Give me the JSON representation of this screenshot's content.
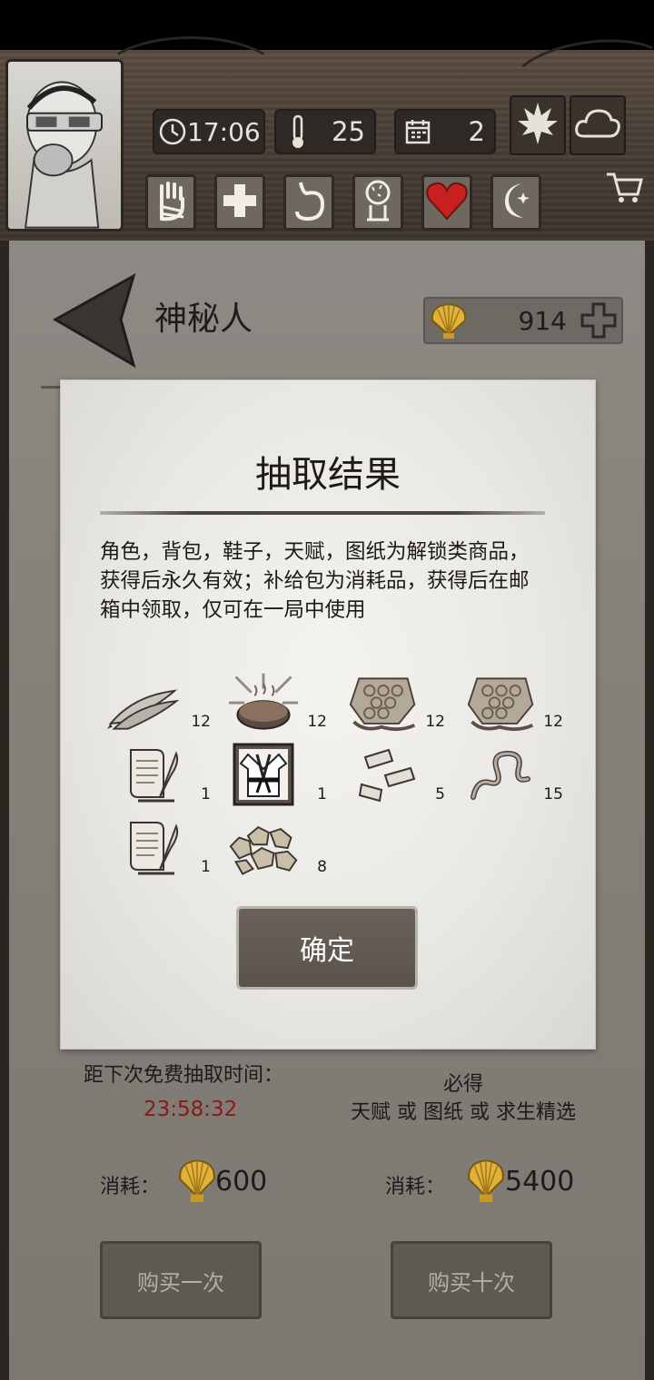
{
  "hud": {
    "time": "17:06",
    "temperature": "25",
    "day": "2",
    "icons": [
      "clock-icon",
      "thermometer-icon",
      "calendar-icon",
      "leaf-icon",
      "cloud-icon"
    ],
    "status_icons": [
      "hand-icon",
      "cross-icon",
      "stomach-icon",
      "brain-icon",
      "heart-icon",
      "moon-icon"
    ],
    "heart_color": "#c8201f"
  },
  "shop": {
    "title": "神秘人",
    "coins": "914"
  },
  "result_modal": {
    "title": "抽取结果",
    "description": "角色，背包，鞋子，天赋，图纸为解锁类商品，获得后永久有效；补给包为消耗品，获得后在邮箱中领取，仅可在一局中使用",
    "items": [
      {
        "icon": "dried-fish-icon",
        "qty": "12"
      },
      {
        "icon": "grilled-meat-icon",
        "qty": "12"
      },
      {
        "icon": "honeycomb-icon",
        "qty": "12"
      },
      {
        "icon": "honeycomb-icon",
        "qty": "12"
      },
      {
        "icon": "scroll-quill-icon",
        "qty": "1"
      },
      {
        "icon": "martial-uniform-icon",
        "qty": "1"
      },
      {
        "icon": "bandage-icon",
        "qty": "5"
      },
      {
        "icon": "rope-icon",
        "qty": "15"
      },
      {
        "icon": "scroll-quill-icon",
        "qty": "1"
      },
      {
        "icon": "ore-nuggets-icon",
        "qty": "8"
      }
    ],
    "confirm_label": "确定"
  },
  "draw_info": {
    "free_label": "距下次免费抽取时间：",
    "free_time": "23:58:32",
    "guarantee_title": "必得",
    "guarantee_text": "天赋 或 图纸 或 求生精选",
    "cost_label": "消耗：",
    "single_cost": "600",
    "ten_cost": "5400",
    "buy_once_label": "购买一次",
    "buy_ten_label": "购买十次"
  }
}
